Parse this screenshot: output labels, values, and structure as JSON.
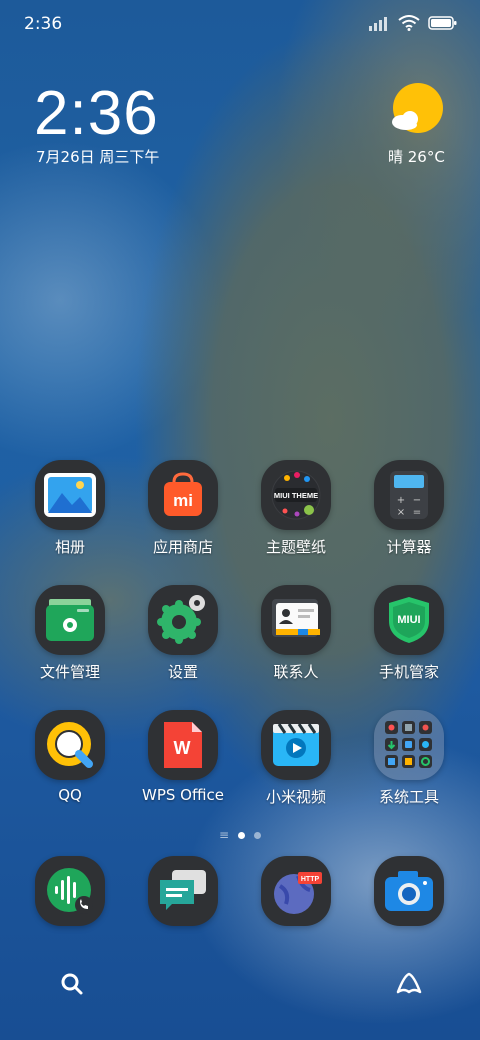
{
  "status_bar": {
    "time": "2:36"
  },
  "clock_widget": {
    "time": "2:36",
    "date": "7月26日 周三下午"
  },
  "weather_widget": {
    "condition_temp": "晴 26°C",
    "icon": "sunny-cloud-icon"
  },
  "apps": [
    {
      "label": "相册",
      "icon": "gallery-icon"
    },
    {
      "label": "应用商店",
      "icon": "app-store-icon"
    },
    {
      "label": "主题壁纸",
      "icon": "themes-icon"
    },
    {
      "label": "计算器",
      "icon": "calculator-icon"
    },
    {
      "label": "文件管理",
      "icon": "file-manager-icon"
    },
    {
      "label": "设置",
      "icon": "settings-icon"
    },
    {
      "label": "联系人",
      "icon": "contacts-icon"
    },
    {
      "label": "手机管家",
      "icon": "security-icon"
    },
    {
      "label": "QQ",
      "icon": "qq-icon"
    },
    {
      "label": "WPS Office",
      "icon": "wps-icon"
    },
    {
      "label": "小米视频",
      "icon": "video-icon"
    },
    {
      "label": "系统工具",
      "icon": "folder-icon"
    }
  ],
  "theme_badge": "MIUI THEME",
  "security_badge": "MIUI",
  "browser_badge": "HTTP",
  "page_indicator": {
    "current": 2,
    "total": 3
  },
  "dock": [
    {
      "icon": "phone-icon"
    },
    {
      "icon": "messages-icon"
    },
    {
      "icon": "browser-icon"
    },
    {
      "icon": "camera-icon"
    }
  ],
  "colors": {
    "tile_bg": "#2f3134",
    "weather_sun": "#ffc107"
  }
}
